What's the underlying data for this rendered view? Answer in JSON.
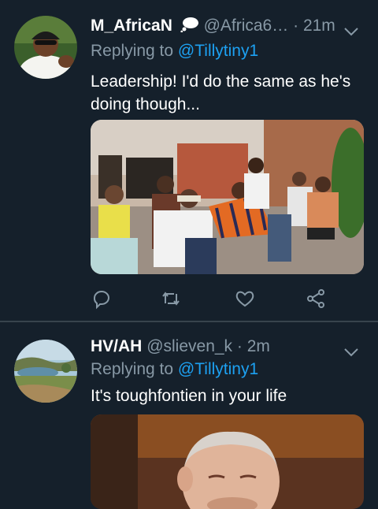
{
  "tweets": [
    {
      "display_name": "M_AfricaN",
      "badge_icon": "thought-bubble-icon",
      "handle": "@Africa6…",
      "separator": "·",
      "time": "21m",
      "replying_prefix": "Replying to ",
      "replying_to": "@Tillytiny1",
      "text": "Leadership! I'd do the same as he's doing though...",
      "has_media": true
    },
    {
      "display_name": "HV/AH",
      "handle": "@slieven_k",
      "separator": "·",
      "time": "2m",
      "replying_prefix": "Replying to ",
      "replying_to": "@Tillytiny1",
      "text": "It's toughfontien in your life",
      "has_media": true
    }
  ],
  "actions": [
    "reply-icon",
    "retweet-icon",
    "like-icon",
    "share-icon"
  ],
  "colors": {
    "background": "#15202b",
    "muted": "#8899a6",
    "link": "#1da1f2",
    "divider": "#38444d"
  }
}
